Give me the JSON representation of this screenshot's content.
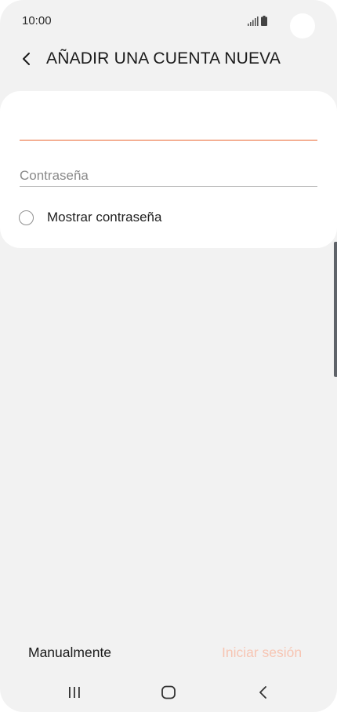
{
  "status_bar": {
    "time": "10:00",
    "icons": [
      "signal-icon",
      "battery-icon"
    ]
  },
  "header": {
    "back_icon": "chevron-left-icon",
    "title": "AÑADIR UNA CUENTA NUEVA"
  },
  "form": {
    "email": {
      "value": "",
      "placeholder": ""
    },
    "password": {
      "value": "",
      "placeholder": "Contraseña"
    },
    "show_password": {
      "label": "Mostrar contraseña",
      "checked": false
    }
  },
  "actions": {
    "manual_label": "Manualmente",
    "signin_label": "Iniciar sesión",
    "signin_enabled": false
  },
  "nav_bar": {
    "icons": [
      "recents-icon",
      "home-icon",
      "back-icon"
    ]
  },
  "colors": {
    "accent": "#e9652f",
    "disabled_accent": "#f7c5b3",
    "background": "#f2f2f2",
    "card": "#ffffff"
  }
}
